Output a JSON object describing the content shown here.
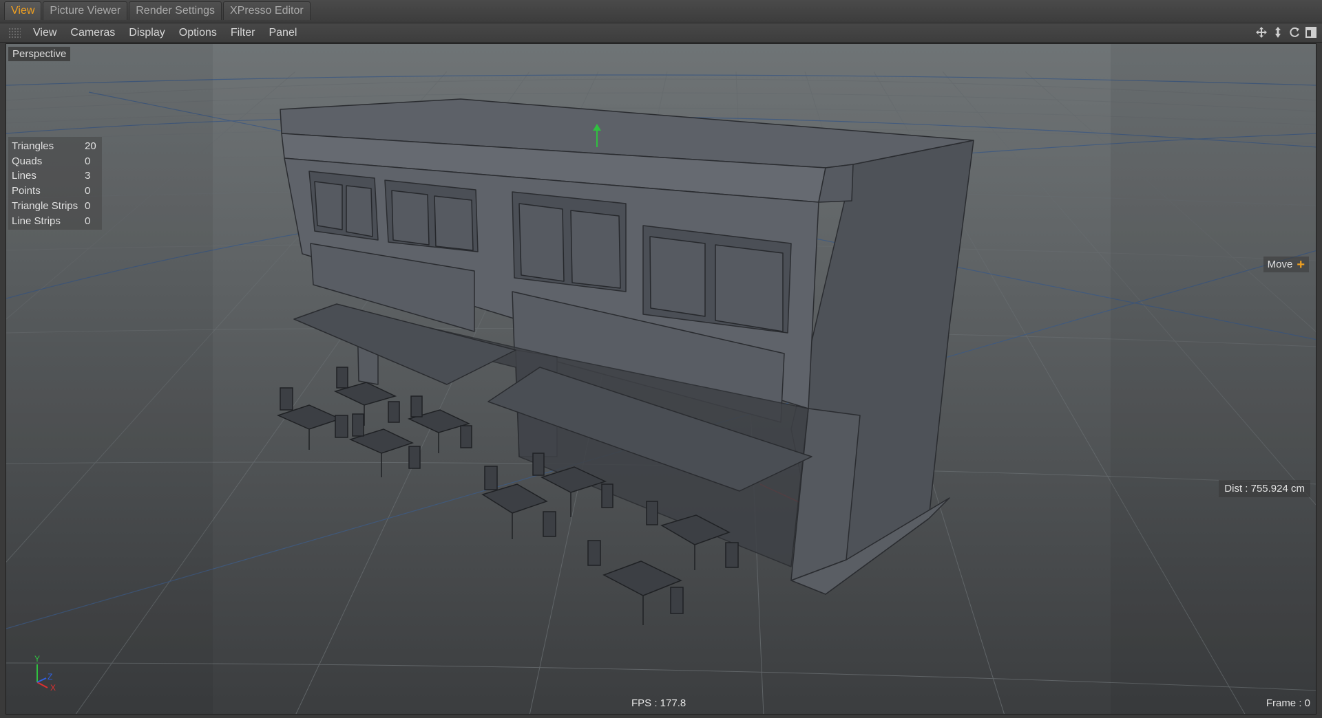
{
  "tabs": [
    {
      "label": "View",
      "active": true
    },
    {
      "label": "Picture Viewer",
      "active": false
    },
    {
      "label": "Render Settings",
      "active": false
    },
    {
      "label": "XPresso Editor",
      "active": false
    }
  ],
  "menu": {
    "items": [
      "View",
      "Cameras",
      "Display",
      "Options",
      "Filter",
      "Panel"
    ],
    "nav_icons": [
      "move-view-icon",
      "dolly-view-icon",
      "rotate-view-icon",
      "toggle-panel-icon"
    ]
  },
  "viewport": {
    "camera_label": "Perspective",
    "stats": [
      {
        "label": "Triangles",
        "value": "20"
      },
      {
        "label": "Quads",
        "value": "0"
      },
      {
        "label": "Lines",
        "value": "3"
      },
      {
        "label": "Points",
        "value": "0"
      },
      {
        "label": "Triangle Strips",
        "value": "0"
      },
      {
        "label": "Line Strips",
        "value": "0"
      }
    ],
    "tool_hud": "Move",
    "distance": "Dist : 755.924 cm",
    "fps": "FPS : 177.8",
    "frame": "Frame : 0",
    "axis_labels": {
      "y": "Y",
      "z": "Z",
      "x": "X"
    }
  },
  "colors": {
    "accent": "#f0a020",
    "x_axis": "#e03030",
    "y_axis": "#30c040",
    "z_axis": "#3060e0",
    "model": "#5b6068",
    "grid": "#5d6163"
  }
}
